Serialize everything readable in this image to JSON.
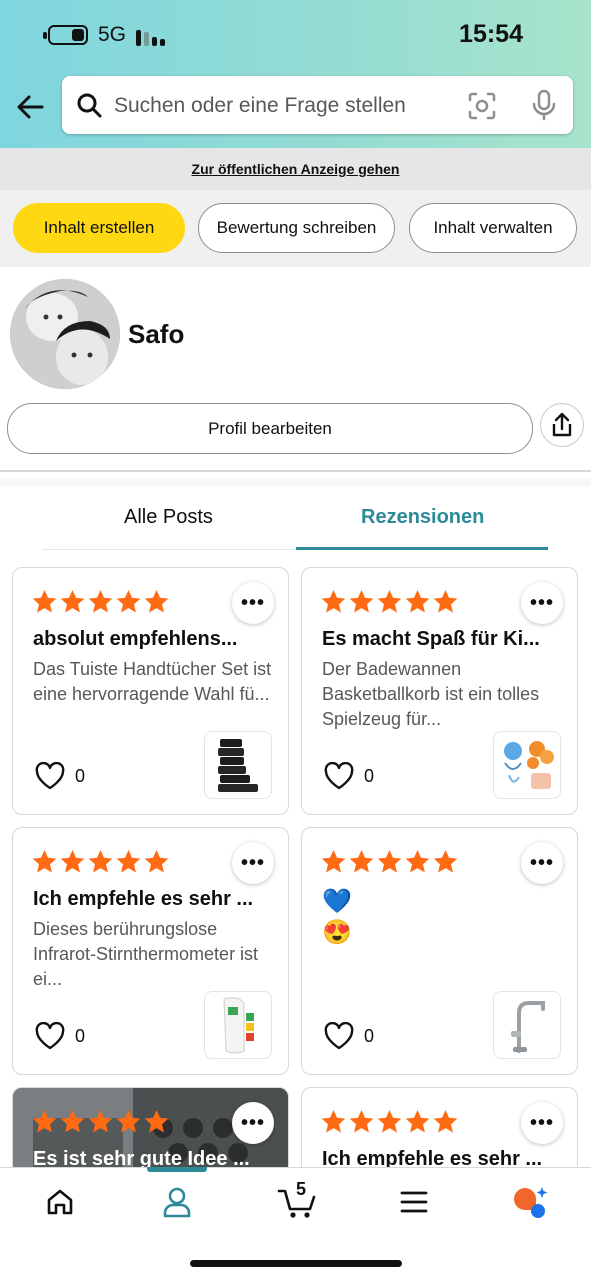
{
  "status_bar": {
    "network": "5G",
    "time": "15:54"
  },
  "search": {
    "placeholder": "Suchen oder eine Frage stellen"
  },
  "public_link": "Zur öffentlichen Anzeige gehen",
  "actions": {
    "create": "Inhalt erstellen",
    "review": "Bewertung schreiben",
    "manage": "Inhalt verwalten"
  },
  "profile": {
    "name": "Safo",
    "edit_label": "Profil bearbeiten"
  },
  "tabs": {
    "all": "Alle Posts",
    "reviews": "Rezensionen",
    "active": "reviews"
  },
  "colors": {
    "accent": "#2d8a99",
    "star": "#ff6a13",
    "primary_button": "#ffd814"
  },
  "reviews": [
    {
      "rating": 5,
      "title": "absolut empfehlens...",
      "body": "Das Tuiste Handtücher Set ist eine hervorragende Wahl fü...",
      "likes": "0",
      "thumbnail": "black-towels"
    },
    {
      "rating": 5,
      "title": "Es macht Spaß für Ki...",
      "body": "Der Badewannen Basketballkorb ist ein tolles Spielzeug für...",
      "likes": "0",
      "thumbnail": "bath-toy"
    },
    {
      "rating": 5,
      "title": "Ich empfehle es sehr ...",
      "body": "Dieses berührungslose Infrarot-Stirnthermometer ist ei...",
      "likes": "0",
      "thumbnail": "thermometer"
    },
    {
      "rating": 5,
      "title": "",
      "emoji": [
        "💙",
        "😍"
      ],
      "likes": "0",
      "thumbnail": "faucet"
    },
    {
      "rating": 5,
      "title": "Es ist sehr gute Idee ...",
      "photo": true
    },
    {
      "rating": 5,
      "title": "Ich empfehle es sehr ..."
    }
  ],
  "bottom_nav": {
    "items": [
      "home-icon",
      "profile-icon",
      "cart-icon",
      "menu-icon",
      "rufus-icon"
    ],
    "active": "profile-icon",
    "cart_count": "5"
  }
}
